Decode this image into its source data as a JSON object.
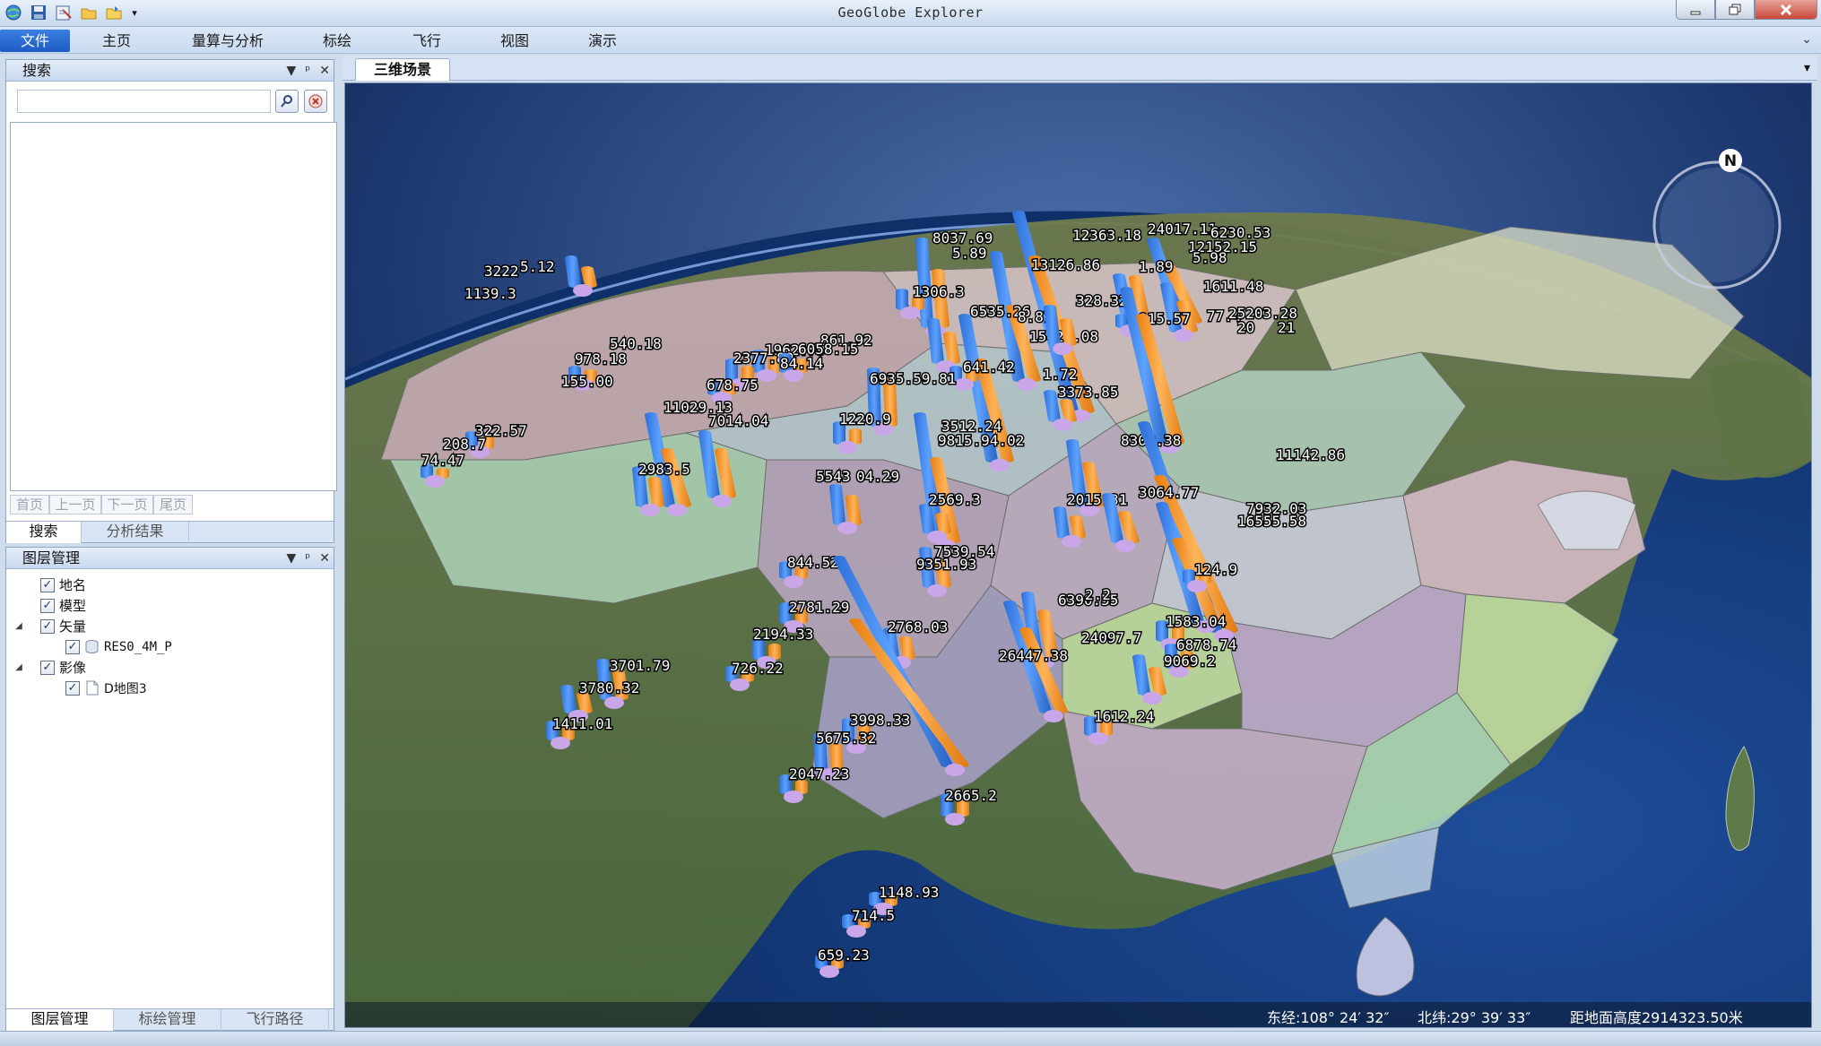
{
  "app": {
    "title": "GeoGlobe Explorer"
  },
  "menu": {
    "file": "文件",
    "home": "主页",
    "measure": "量算与分析",
    "annotate": "标绘",
    "fly": "飞行",
    "view": "视图",
    "demo": "演示"
  },
  "search_panel": {
    "title": "搜索",
    "input_value": "",
    "pager": [
      "首页",
      "上一页",
      "下一页",
      "尾页"
    ],
    "tabs": [
      "搜索",
      "分析结果"
    ]
  },
  "layer_panel": {
    "title": "图层管理",
    "layers": [
      {
        "label": "地名",
        "checked": true,
        "level": 0,
        "expandable": false
      },
      {
        "label": "模型",
        "checked": true,
        "level": 0,
        "expandable": false
      },
      {
        "label": "矢量",
        "checked": true,
        "level": 0,
        "expandable": true
      },
      {
        "label": "RES0_4M_P",
        "checked": true,
        "level": 1,
        "expandable": false,
        "icon": "database-icon"
      },
      {
        "label": "影像",
        "checked": true,
        "level": 0,
        "expandable": true
      },
      {
        "label": "D地图3",
        "checked": true,
        "level": 1,
        "expandable": false,
        "icon": "document-icon"
      }
    ],
    "tabs": [
      "图层管理",
      "标绘管理",
      "飞行路径"
    ]
  },
  "scene": {
    "tab": "三维场景",
    "compass_label": "N",
    "status": {
      "longitude": "东经:108° 24′ 32″",
      "latitude": "北纬:29° 39′ 33″",
      "altitude": "距地面高度2914323.50米"
    }
  },
  "colors": {
    "series_a": "#3d86f0",
    "series_b": "#ff9a2e",
    "series_c": "#c9a6e8"
  },
  "scene_labels": [
    "3222",
    "5.12",
    "1139.3",
    "8037.69",
    "5.89",
    "12363.18",
    "24017.11",
    "6230.53",
    "12152.15",
    "13126.86",
    "1.89",
    "5.98",
    "1611.48",
    "1306.3",
    "6535.26",
    "8.87",
    "15427.08",
    "328.32",
    "915.57",
    "77.4",
    "25203.28",
    "20",
    "21",
    "978.18",
    "540.18",
    "155.00",
    "1962.79",
    "2377.89",
    "861.92",
    "6058.15",
    "84.14",
    "678.75",
    "641.42",
    "6935.59.81",
    "3373.85",
    "1.72",
    "322.57",
    "208.7",
    "74.47",
    "11029.13",
    "7014.04",
    "1220.9",
    "3512.24",
    "9815.94.02",
    "8309.38",
    "11142.86",
    "2983.5",
    "5543",
    "04.29",
    "2569.3",
    "2015.31",
    "3064.77",
    "7932.03",
    "16555.58",
    "844.52",
    "7539.54",
    "9351.93",
    "124.9",
    "2781.29",
    "2194.33",
    "6390.55",
    "2.2",
    "2768.03",
    "24097.7",
    "1583.04",
    "6878.74",
    "726.22",
    "26447.38",
    "9069.2",
    "3701.79",
    "3780.32",
    "1411.01",
    "3998.33",
    "5675.32",
    "1612.24",
    "2047.23",
    "2665.2",
    "1148.93",
    "714.5",
    "659.23"
  ]
}
